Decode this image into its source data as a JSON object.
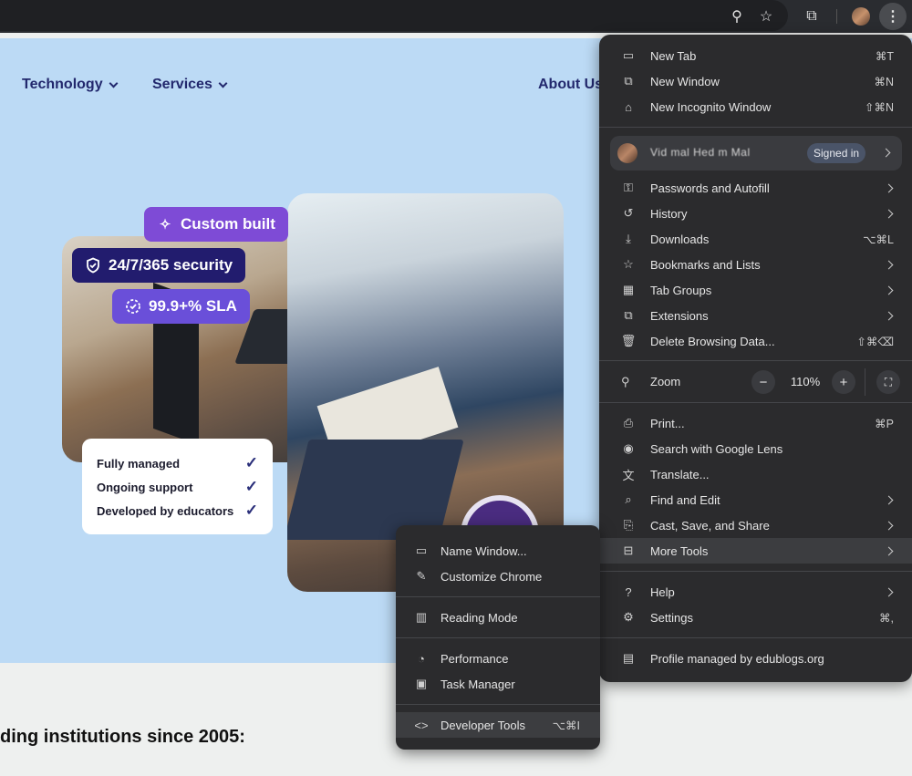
{
  "toolbar": {
    "zoom_icon": "⚲",
    "star_icon": "☆",
    "extensions_icon": "⧉",
    "menu_icon": "⋮"
  },
  "site": {
    "nav": [
      "Technology",
      "Services",
      "About Us"
    ],
    "badges": {
      "custom": "Custom built",
      "security": "24/7/365 security",
      "sla": "99.9+% SLA"
    },
    "checklist": [
      "Fully managed",
      "Ongoing support",
      "Developed by educators"
    ],
    "headline": "ding institutions since 2005:"
  },
  "menu": {
    "new_tab": {
      "label": "New Tab",
      "shortcut": "⌘T"
    },
    "new_window": {
      "label": "New Window",
      "shortcut": "⌘N"
    },
    "new_incognito": {
      "label": "New Incognito Window",
      "shortcut": "⇧⌘N"
    },
    "profile": {
      "name": "Vid mal Hed m Mal",
      "status": "Signed in"
    },
    "passwords": {
      "label": "Passwords and Autofill"
    },
    "history": {
      "label": "History"
    },
    "downloads": {
      "label": "Downloads",
      "shortcut": "⌥⌘L"
    },
    "bookmarks": {
      "label": "Bookmarks and Lists"
    },
    "tab_groups": {
      "label": "Tab Groups"
    },
    "extensions": {
      "label": "Extensions"
    },
    "delete_data": {
      "label": "Delete Browsing Data...",
      "shortcut": "⇧⌘⌫"
    },
    "zoom": {
      "label": "Zoom",
      "value": "110%",
      "minus": "−",
      "plus": "+"
    },
    "print": {
      "label": "Print...",
      "shortcut": "⌘P"
    },
    "google_lens": {
      "label": "Search with Google Lens"
    },
    "translate": {
      "label": "Translate..."
    },
    "find_edit": {
      "label": "Find and Edit"
    },
    "cast_save": {
      "label": "Cast, Save, and Share"
    },
    "more_tools": {
      "label": "More Tools"
    },
    "help": {
      "label": "Help"
    },
    "settings": {
      "label": "Settings",
      "shortcut": "⌘,"
    },
    "managed": {
      "label": "Profile managed by edublogs.org"
    }
  },
  "submenu": {
    "name_window": "Name Window...",
    "customize": "Customize Chrome",
    "reading_mode": "Reading Mode",
    "performance": "Performance",
    "task_manager": "Task Manager",
    "devtools": {
      "label": "Developer Tools",
      "shortcut": "⌥⌘I"
    }
  }
}
